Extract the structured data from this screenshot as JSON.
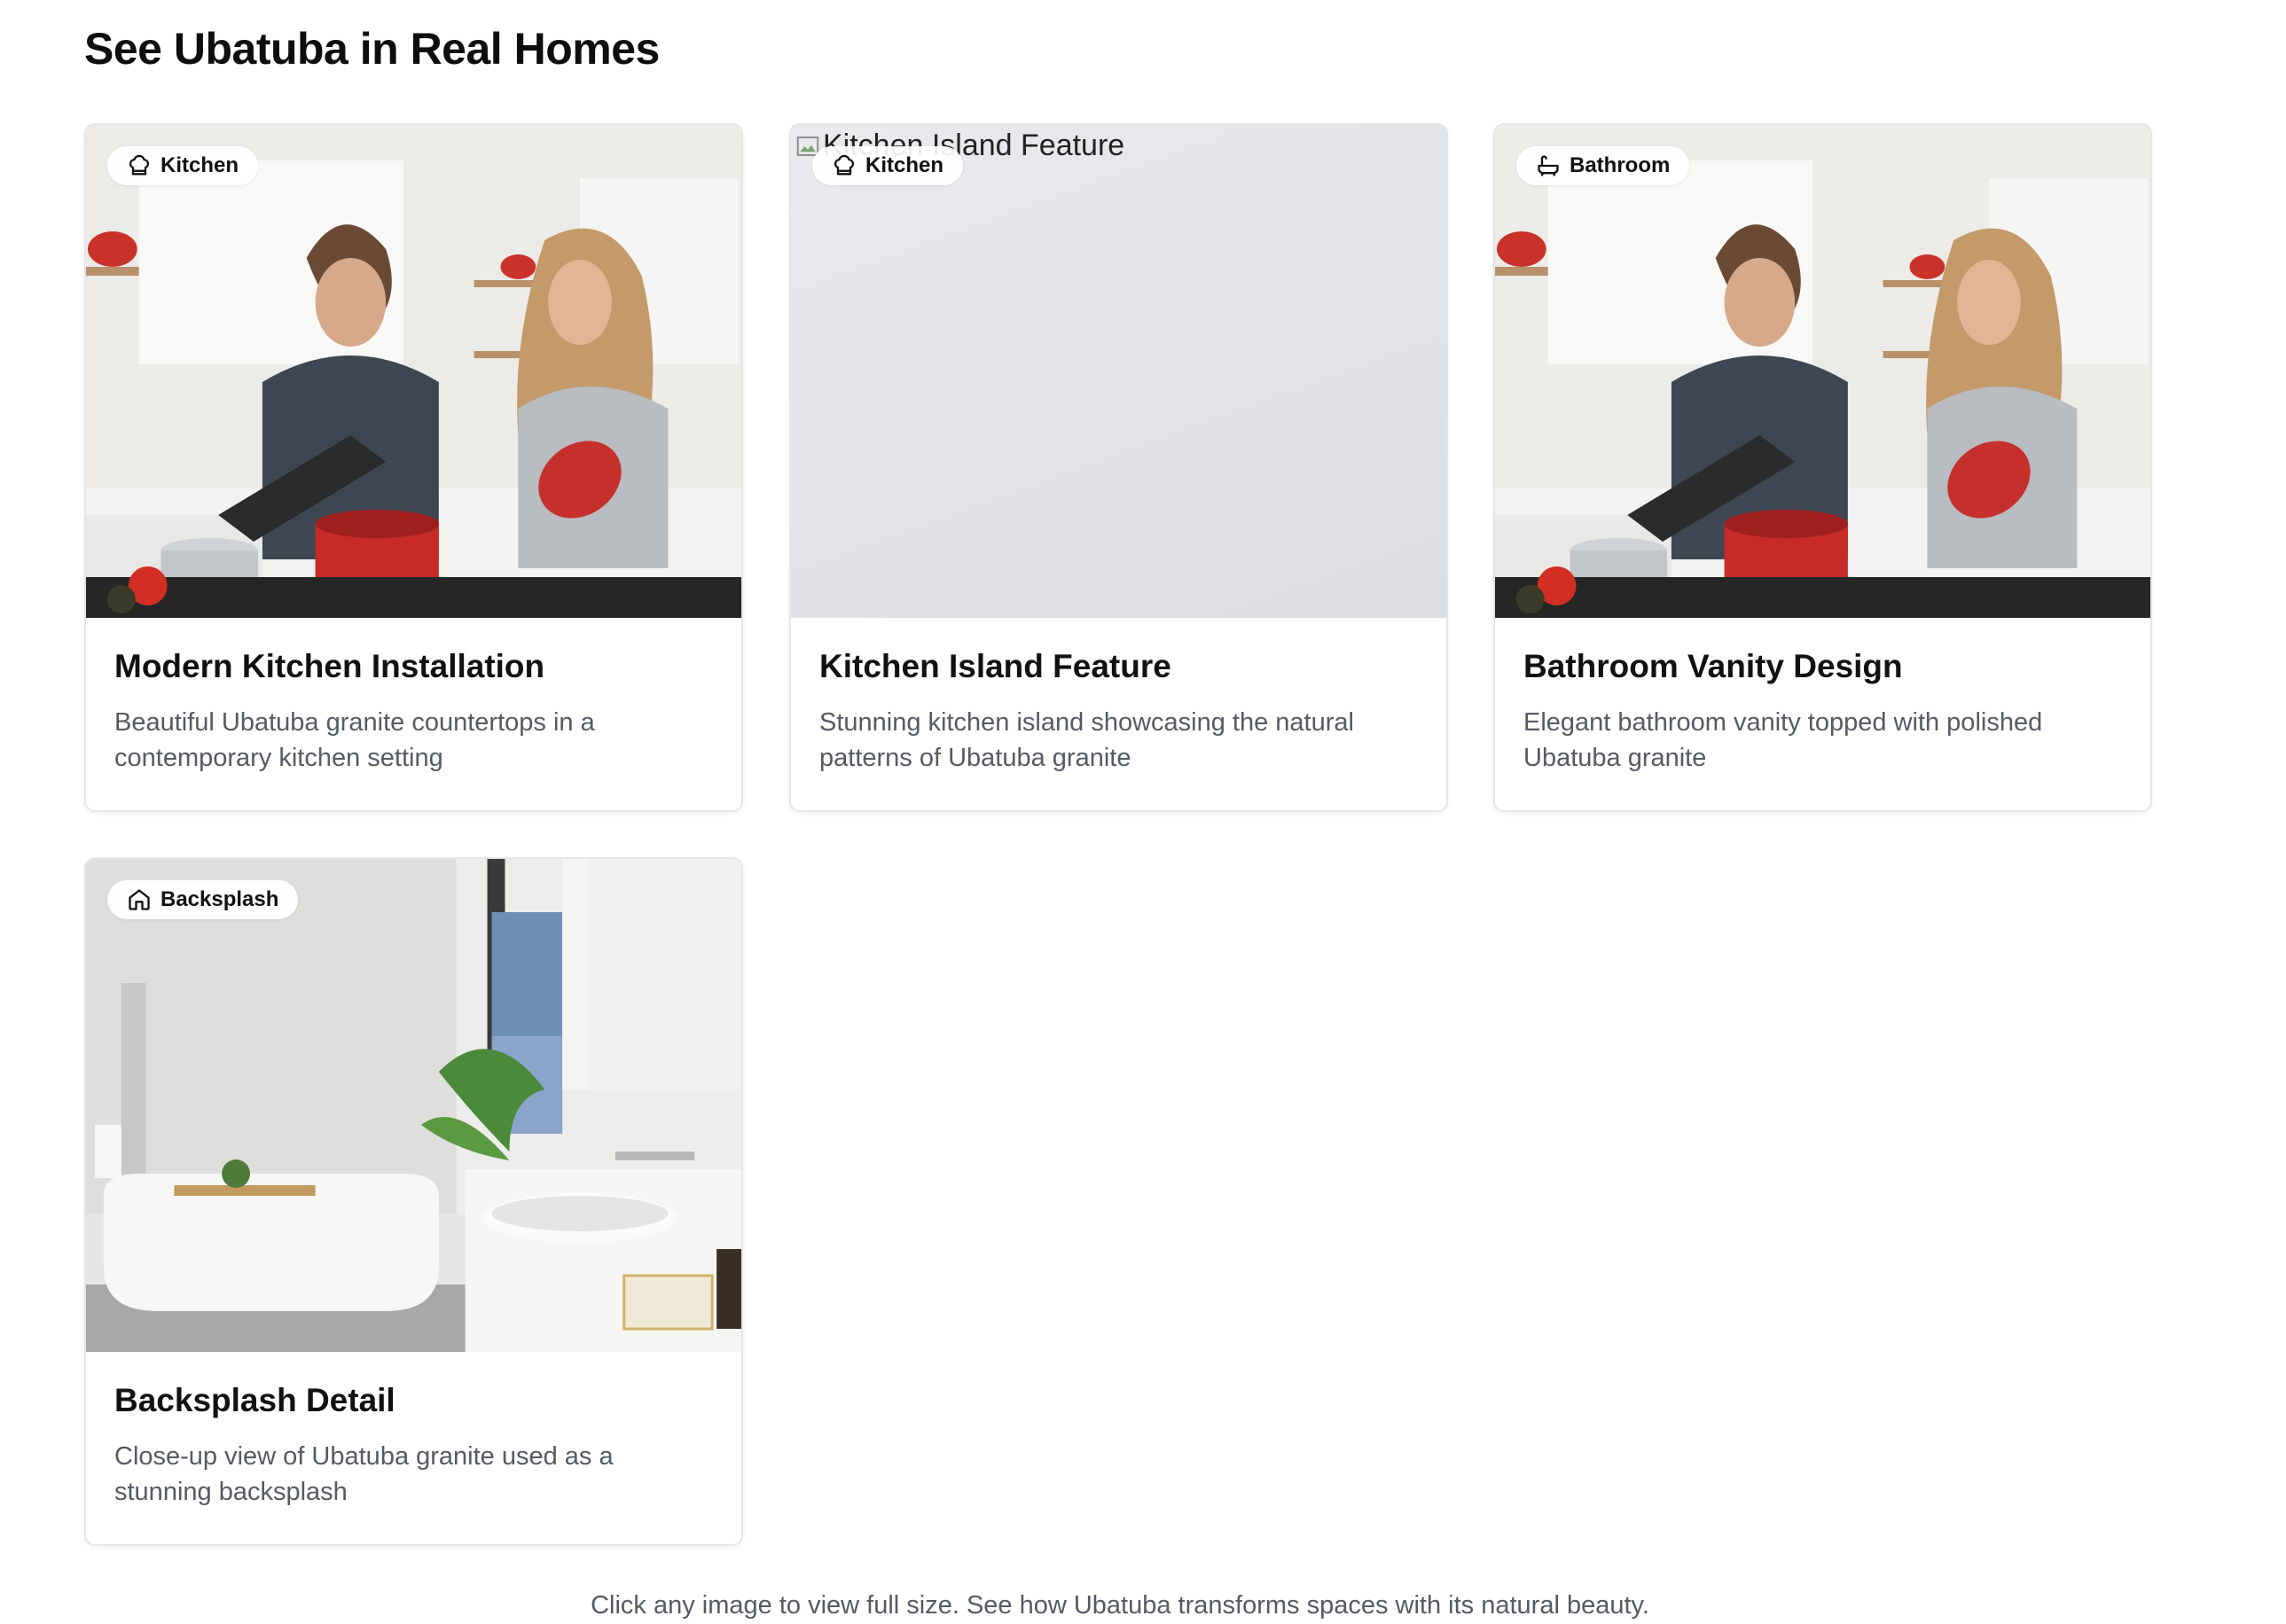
{
  "page": {
    "title": "See Ubatuba in Real Homes",
    "footer_note": "Click any image to view full size. See how Ubatuba transforms spaces with its natural beauty."
  },
  "gallery": [
    {
      "tag": "Kitchen",
      "tag_icon": "chef-hat-icon",
      "title": "Modern Kitchen Installation",
      "description": "Beautiful Ubatuba granite countertops in a contemporary kitchen setting",
      "image": "photo-couple-cooking-kitchen"
    },
    {
      "tag": "Kitchen",
      "tag_icon": "chef-hat-icon",
      "title": "Kitchen Island Feature",
      "description": "Stunning kitchen island showcasing the natural patterns of Ubatuba granite",
      "image_alt": "Kitchen Island Feature",
      "image": "broken-image"
    },
    {
      "tag": "Bathroom",
      "tag_icon": "bathtub-icon",
      "title": "Bathroom Vanity Design",
      "description": "Elegant bathroom vanity topped with polished Ubatuba granite",
      "image": "photo-couple-cooking-kitchen"
    },
    {
      "tag": "Backsplash",
      "tag_icon": "home-icon",
      "title": "Backsplash Detail",
      "description": "Close-up view of Ubatuba granite used as a stunning backsplash",
      "image": "photo-white-bathroom"
    }
  ]
}
